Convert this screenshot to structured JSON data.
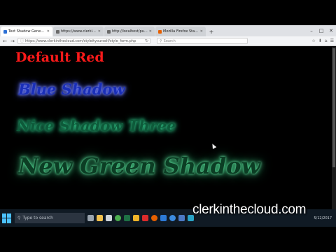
{
  "browser": {
    "tabs": [
      {
        "label": "Text Shadow Generator",
        "active": true,
        "favicon_color": "#2b6fd6"
      },
      {
        "label": "https://www.clerkinthecloud.co",
        "active": false,
        "favicon_color": "#6a6a6a"
      },
      {
        "label": "http://localhost/public_html/st",
        "active": false,
        "favicon_color": "#6a6a6a"
      },
      {
        "label": "Mozilla Firefox Start Page",
        "active": false,
        "favicon_color": "#e66000"
      }
    ],
    "new_tab": "+",
    "window_controls": {
      "minimize": "–",
      "maximize": "□",
      "close": "✕"
    },
    "nav": {
      "back": "←",
      "forward": "→",
      "url": "https://www.clerkinthecloud.com/styleityourself/style_form.php",
      "reload": "↻",
      "search_placeholder": "Search",
      "toolbar_icons": [
        "☆",
        "⬇",
        "⌂",
        "☰"
      ]
    }
  },
  "page": {
    "headings": [
      {
        "text": "Default Red",
        "color": "#ff1a1a"
      },
      {
        "text": "Blue Shadow",
        "color": "#1a2fb8",
        "shadow": "#6a7bff"
      },
      {
        "text": "Nice Shadow Three",
        "color": "#0e5a3a",
        "shadow": "#3adf9a"
      },
      {
        "text": "New Green Shadow",
        "color": "#0c3d24",
        "shadow": "#4bd18c"
      }
    ]
  },
  "taskbar": {
    "search_placeholder": "Type to search",
    "clock_time": "",
    "clock_date": "5/12/2017",
    "pinned_icons": [
      {
        "name": "task-view-icon",
        "color": "#9aa4ae"
      },
      {
        "name": "file-explorer-icon",
        "color": "#f2c14e"
      },
      {
        "name": "store-icon",
        "color": "#cfd5db"
      },
      {
        "name": "chrome-icon",
        "color": "#4caf50"
      },
      {
        "name": "excel-icon",
        "color": "#1e7145"
      },
      {
        "name": "files-icon",
        "color": "#f0b429"
      },
      {
        "name": "filezilla-icon",
        "color": "#d92b2b"
      },
      {
        "name": "firefox-icon",
        "color": "#e66000"
      },
      {
        "name": "edge-icon",
        "color": "#2d7ad6"
      },
      {
        "name": "ie-icon",
        "color": "#3c8be0"
      },
      {
        "name": "app-icon-1",
        "color": "#4c79c4"
      },
      {
        "name": "app-icon-2",
        "color": "#29a3c7"
      }
    ]
  },
  "watermark": "clerkinthecloud.com"
}
